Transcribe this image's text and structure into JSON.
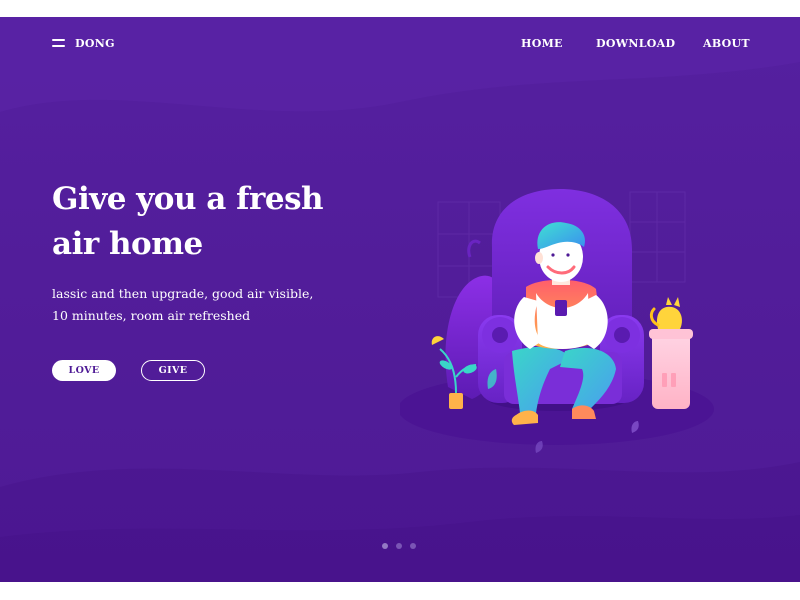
{
  "nav": {
    "brand": "DONG",
    "links": [
      {
        "label": "HOME"
      },
      {
        "label": "DOWNLOAD"
      },
      {
        "label": "ABOUT"
      }
    ]
  },
  "hero": {
    "title": "Give you a fresh air home",
    "description": "lassic and then upgrade, good air visible,\n10 minutes, room air refreshed",
    "buttons": {
      "primary": "LOVE",
      "secondary": "GIVE"
    }
  },
  "pager": {
    "count": 3,
    "active_index": 0
  },
  "colors": {
    "background": "#521d9a",
    "text": "#ffffff",
    "button_primary_text": "#4e1a95"
  },
  "icons": {
    "menu": "hamburger-menu-icon"
  }
}
